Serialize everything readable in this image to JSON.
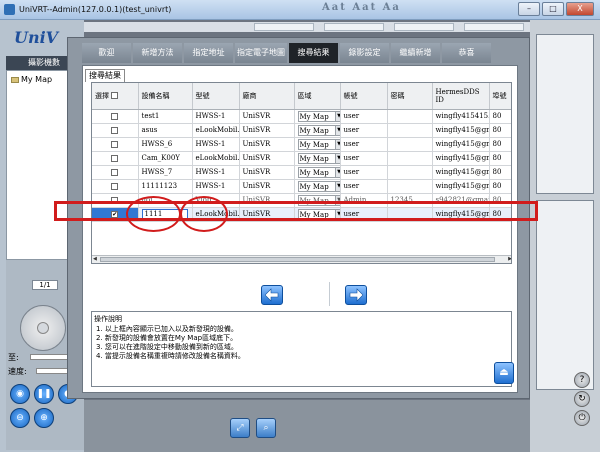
{
  "window": {
    "title": "UniVRT--Admin(127.0.0.1)(test_univrt)",
    "font_buttons": "Aat Aat Aa",
    "buttons": [
      "–",
      "□",
      "X"
    ]
  },
  "left": {
    "logo": "UniV",
    "camera_tab": "攝影機數",
    "tree_root": "My Map",
    "pager": "1/1",
    "label_zoom": "至:",
    "label_speed": "速度:"
  },
  "dialog": {
    "tabs": [
      "歡迎",
      "新增方法",
      "指定地址",
      "指定電子地圖",
      "搜尋結果",
      "錄影設定",
      "繼續新增",
      "恭喜"
    ],
    "active_tab": "搜尋結果",
    "subtab": "搜尋結果",
    "columns": [
      "選擇",
      "設備名稱",
      "型號",
      "廠商",
      "區域",
      "帳號",
      "密碼",
      "HermesDDS ID",
      "埠號"
    ],
    "rows": [
      {
        "name": "test1",
        "model": "HWSS-1",
        "vendor": "UniSVR",
        "area": "My Map",
        "account": "user",
        "password": "",
        "ddsid": "wingfly415415...",
        "port": "80",
        "checked": false
      },
      {
        "name": "asus",
        "model": "eLookMobil...",
        "vendor": "UniSVR",
        "area": "My Map",
        "account": "user",
        "password": "",
        "ddsid": "wingfly415@gm...",
        "port": "80",
        "checked": false
      },
      {
        "name": "HWSS_6",
        "model": "HWSS-1",
        "vendor": "UniSVR",
        "area": "My Map",
        "account": "user",
        "password": "",
        "ddsid": "wingfly415@gm...",
        "port": "80",
        "checked": false
      },
      {
        "name": "Cam_K00Y",
        "model": "eLookMobil...",
        "vendor": "UniSVR",
        "area": "My Map",
        "account": "user",
        "password": "",
        "ddsid": "wingfly415@gm...",
        "port": "80",
        "checked": false
      },
      {
        "name": "HWSS_7",
        "model": "HWSS-1",
        "vendor": "UniSVR",
        "area": "My Map",
        "account": "user",
        "password": "",
        "ddsid": "wingfly415@gm...",
        "port": "80",
        "checked": false
      },
      {
        "name": "11111123",
        "model": "HWSS-1",
        "vendor": "UniSVR",
        "area": "My Map",
        "account": "user",
        "password": "",
        "ddsid": "wingfly415@gm...",
        "port": "80",
        "checked": false
      },
      {
        "name": "uoi",
        "model": "Viob",
        "vendor": "UniSVR",
        "area": "My Map",
        "account": "Admin",
        "password": "12345",
        "ddsid": "s942821@gmail...",
        "port": "80",
        "checked": false
      },
      {
        "name": "1111",
        "model": "eLookMobil...",
        "vendor": "UniSVR",
        "area": "My Map",
        "account": "user",
        "password": "",
        "ddsid": "wingfly415@gm...",
        "port": "80",
        "checked": true
      }
    ],
    "instructions": {
      "title": "操作說明",
      "lines": [
        "1. 以上框內容顯示已加入以及新發現的設備。",
        "2. 新發現的設備會放置在My Map區域底下。",
        "3. 您可以在進階設定中移動設備到新的區域。",
        "4. 當提示設備名稱重複時請修改設備名稱資料。"
      ]
    }
  },
  "colors": {
    "annotation_red": "#d11c1c",
    "active_tab": "#1f2328",
    "selection_blue": "#3178d4"
  }
}
